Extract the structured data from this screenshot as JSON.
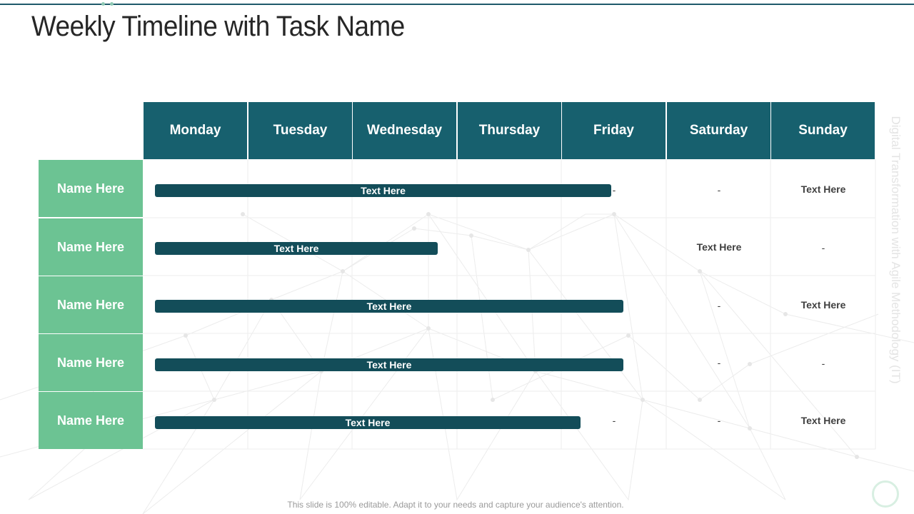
{
  "title": "Weekly Timeline with Task Name",
  "days": [
    "Monday",
    "Tuesday",
    "Wednesday",
    "Thursday",
    "Friday",
    "Saturday",
    "Sunday"
  ],
  "rows": [
    {
      "name": "Name Here",
      "task": "Text Here",
      "friday": "-",
      "saturday": "-",
      "sunday": "Text Here"
    },
    {
      "name": "Name Here",
      "task": "Text Here",
      "friday": "",
      "saturday": "Text Here",
      "sunday": "-"
    },
    {
      "name": "Name Here",
      "task": "Text Here",
      "friday": "",
      "saturday": "-",
      "sunday": "Text Here"
    },
    {
      "name": "Name Here",
      "task": "Text Here",
      "friday": "",
      "saturday": "-",
      "sunday": "-"
    },
    {
      "name": "Name Here",
      "task": "Text Here",
      "friday": "-",
      "saturday": "-",
      "sunday": "Text Here"
    }
  ],
  "side_label": "Digital Transformation with Agile Methodology (IT)",
  "footer": "This slide is 100% editable. Adapt it to your needs and capture your audience's attention.",
  "colors": {
    "header_bg": "#17606e",
    "name_bg": "#6cc393",
    "bar_bg": "#134d59",
    "accent_line": "#1f5a6b"
  }
}
